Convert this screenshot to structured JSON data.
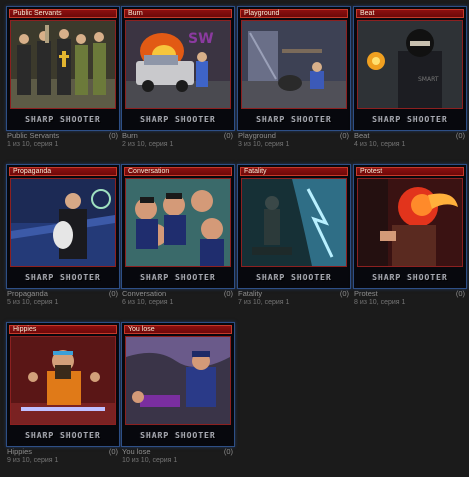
{
  "brand_logo_text": "SHARP SHOOTER",
  "cards": [
    {
      "title": "Public Servants",
      "name": "Public Servants",
      "count": "(0)",
      "series": "1 из 10, серия 1",
      "scene": "officials"
    },
    {
      "title": "Burn",
      "name": "Burn",
      "count": "(0)",
      "series": "2 из 10, серия 1",
      "scene": "car-fire"
    },
    {
      "title": "Playground",
      "name": "Playground",
      "count": "(0)",
      "series": "3 из 10, серия 1",
      "scene": "playground"
    },
    {
      "title": "Beat",
      "name": "Beat",
      "count": "(0)",
      "series": "4 из 10, серия 1",
      "scene": "masked"
    },
    {
      "title": "Propaganda",
      "name": "Propaganda",
      "count": "(0)",
      "series": "5 из 10, серия 1",
      "scene": "tv-man"
    },
    {
      "title": "Conversation",
      "name": "Conversation",
      "count": "(0)",
      "series": "6 из 10, серия 1",
      "scene": "police-crowd"
    },
    {
      "title": "Fatality",
      "name": "Fatality",
      "count": "(0)",
      "series": "7 из 10, серия 1",
      "scene": "cave"
    },
    {
      "title": "Protest",
      "name": "Protest",
      "count": "(0)",
      "series": "8 из 10, серия 1",
      "scene": "burning-man"
    },
    {
      "title": "Hippies",
      "name": "Hippies",
      "count": "(0)",
      "series": "9 из 10, серия 1",
      "scene": "hippie"
    },
    {
      "title": "You lose",
      "name": "You lose",
      "count": "(0)",
      "series": "10 из 10, серия 1",
      "scene": "you-lose"
    }
  ]
}
